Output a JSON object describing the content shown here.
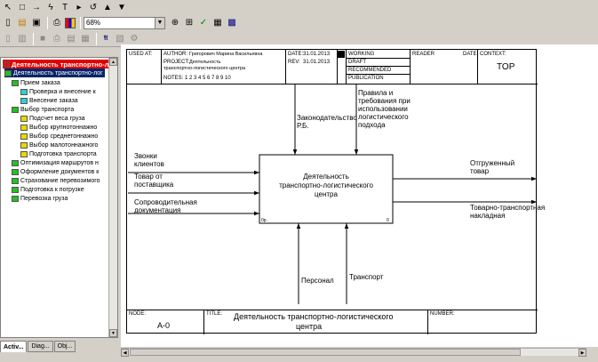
{
  "toolbar": {
    "zoom_value": "68%",
    "icons_row1": [
      "pointer-icon",
      "box-icon",
      "arrow-icon",
      "squiggle-icon",
      "text-icon",
      "tunnel-icon",
      "rotate-icon",
      "triangle-up-icon",
      "triangle-down-icon"
    ],
    "icons_row2": [
      "new-icon",
      "open-icon",
      "save-icon",
      "print-icon",
      "color-icon"
    ],
    "icons_row2b": [
      "zoom-in-icon",
      "zoom-out-icon",
      "spellcheck-icon",
      "model-explorer-icon",
      "report-icon"
    ]
  },
  "tree": {
    "items": [
      {
        "label": "Деятельность транспортно-л",
        "level": 0,
        "icon": "red",
        "style": "root"
      },
      {
        "label": "Деятельность транспортно-лог",
        "level": 1,
        "icon": "green",
        "style": "sel"
      },
      {
        "label": "Прием заказа",
        "level": 2,
        "icon": "green",
        "style": ""
      },
      {
        "label": "Проверка и внесение к",
        "level": 3,
        "icon": "cyan",
        "style": ""
      },
      {
        "label": "Внесение заказа",
        "level": 3,
        "icon": "cyan",
        "style": ""
      },
      {
        "label": "Выбор транспорта",
        "level": 2,
        "icon": "green",
        "style": ""
      },
      {
        "label": "Подсчет веса груза",
        "level": 3,
        "icon": "yellow",
        "style": ""
      },
      {
        "label": "Выбор крупнотоннажно",
        "level": 3,
        "icon": "yellow",
        "style": ""
      },
      {
        "label": "Выбор среднетоннажно",
        "level": 3,
        "icon": "yellow",
        "style": ""
      },
      {
        "label": "Выбор малотоннажного",
        "level": 3,
        "icon": "yellow",
        "style": ""
      },
      {
        "label": "Подготовка транспорта",
        "level": 3,
        "icon": "yellow",
        "style": ""
      },
      {
        "label": "Оптимизация маршрутов н",
        "level": 2,
        "icon": "green",
        "style": ""
      },
      {
        "label": "Оформление документов к",
        "level": 2,
        "icon": "green",
        "style": ""
      },
      {
        "label": "Страхование перевозимого",
        "level": 2,
        "icon": "green",
        "style": ""
      },
      {
        "label": "Подготовка к погрузке",
        "level": 2,
        "icon": "green",
        "style": ""
      },
      {
        "label": "Перевозка груза",
        "level": 2,
        "icon": "green",
        "style": ""
      }
    ]
  },
  "tabs": [
    {
      "label": "Activ..."
    },
    {
      "label": "Diag..."
    },
    {
      "label": "Obj..."
    }
  ],
  "header": {
    "used_at": "USED AT:",
    "author_label": "AUTHOR:",
    "author": "Григорович Марина Васильевна",
    "date_label": "DATE:",
    "date": "31.01.2013",
    "project_label": "PROJECT:",
    "project": "Деятельность",
    "project_2": "транспортно-логистического центра",
    "rev_label": "REV:",
    "rev": "31.01.2013",
    "notes": "NOTES:  1  2  3  4  5  6  7  8  9  10",
    "status": [
      "WORKING",
      "DRAFT",
      "RECOMMENDED",
      "PUBLICATION"
    ],
    "reader": "READER",
    "date2": "DATE",
    "context_label": "CONTEXT:",
    "context_value": "TOP"
  },
  "footer": {
    "node_label": "NODE:",
    "node_value": "A-0",
    "title_label": "TITLE:",
    "title_1": "Деятельность  транспортно-логистического",
    "title_2": "центра",
    "number_label": "NUMBER:"
  },
  "diagram": {
    "box_title": [
      "Деятельность",
      "транспортно-логистического",
      "центра"
    ],
    "box_corner_left": "0р.",
    "box_corner_right": "0",
    "controls": [
      {
        "lines": [
          "Законодательство",
          "Р.Б."
        ]
      },
      {
        "lines": [
          "Правила и",
          "требования при",
          "использовании",
          "логистического",
          "подхода"
        ]
      }
    ],
    "inputs": [
      {
        "lines": [
          "Звонки",
          "клиентов"
        ]
      },
      {
        "lines": [
          "Товар от",
          "поставщика"
        ]
      },
      {
        "lines": [
          "Сопроводительная",
          "документация"
        ]
      }
    ],
    "outputs": [
      {
        "lines": [
          "Отгруженный",
          "товар"
        ]
      },
      {
        "lines": [
          "Товарно-транспортная",
          "накладная"
        ]
      }
    ],
    "mechanisms": [
      {
        "lines": [
          "Персонал"
        ]
      },
      {
        "lines": [
          "Транспорт"
        ]
      }
    ]
  }
}
